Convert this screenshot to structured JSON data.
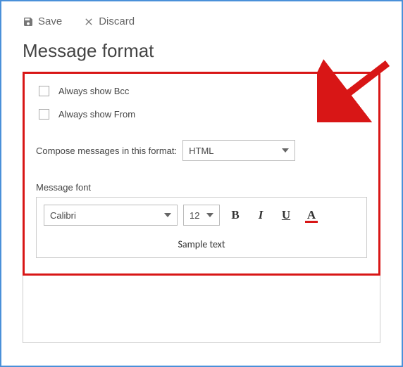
{
  "toolbar": {
    "save_label": "Save",
    "discard_label": "Discard"
  },
  "title": "Message format",
  "options": {
    "always_show_bcc": "Always show Bcc",
    "always_show_from": "Always show From"
  },
  "compose": {
    "label": "Compose messages in this format:",
    "value": "HTML"
  },
  "font_section": {
    "label": "Message font",
    "font_family": "Calibri",
    "font_size": "12",
    "bold": "B",
    "italic": "I",
    "underline": "U",
    "color": "A",
    "sample": "Sample text"
  }
}
